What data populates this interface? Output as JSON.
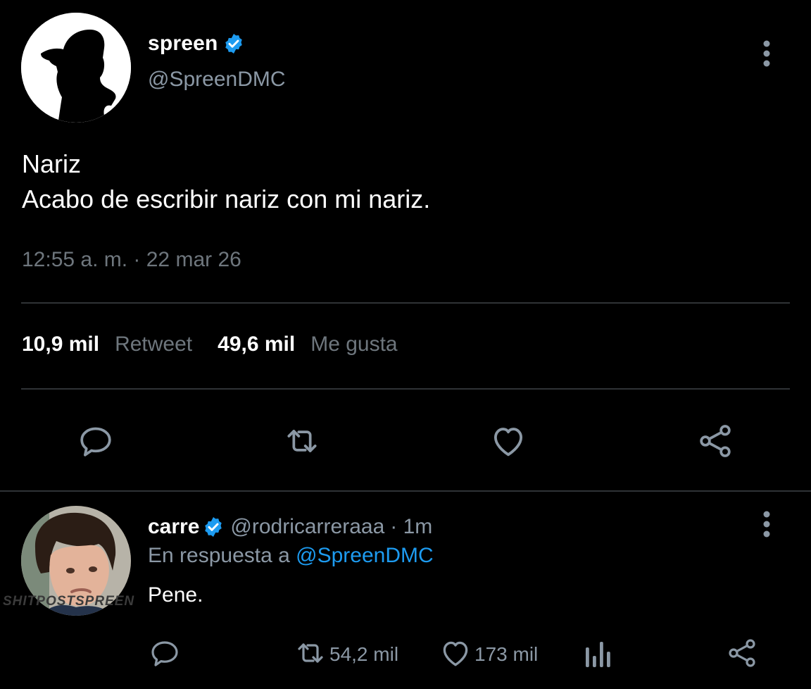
{
  "tweet": {
    "author_name": "spreen",
    "author_handle": "@SpreenDMC",
    "verified": true,
    "text_line1": "Nariz",
    "text_line2": "Acabo de escribir nariz con mi nariz.",
    "timestamp": "12:55 a. m. · 22 mar 26",
    "retweets_count": "10,9 mil",
    "retweets_label": "Retweet",
    "likes_count": "49,6 mil",
    "likes_label": "Me gusta",
    "actions": [
      "reply-icon",
      "retweet-icon",
      "heart-icon",
      "share-icon"
    ]
  },
  "reply": {
    "author_name": "carre",
    "author_handle": "@rodricarreraaa",
    "time_ago": "· 1m",
    "verified": true,
    "in_reply_prefix": "En respuesta a",
    "in_reply_handle": "@SpreenDMC",
    "text": "Pene.",
    "retweets_count": "54,2 mil",
    "likes_count": "173 mil",
    "watermark": "SHITPOSTSPREEN",
    "actions": [
      "reply-icon",
      "retweet-icon",
      "heart-icon",
      "analytics-icon",
      "share-icon"
    ]
  },
  "colors": {
    "background": "#000000",
    "text_primary": "#ffffff",
    "text_secondary": "#8b98a5",
    "link": "#1d9bf0",
    "divider": "#2f3336",
    "verified_badge": "#1d9bf0"
  }
}
